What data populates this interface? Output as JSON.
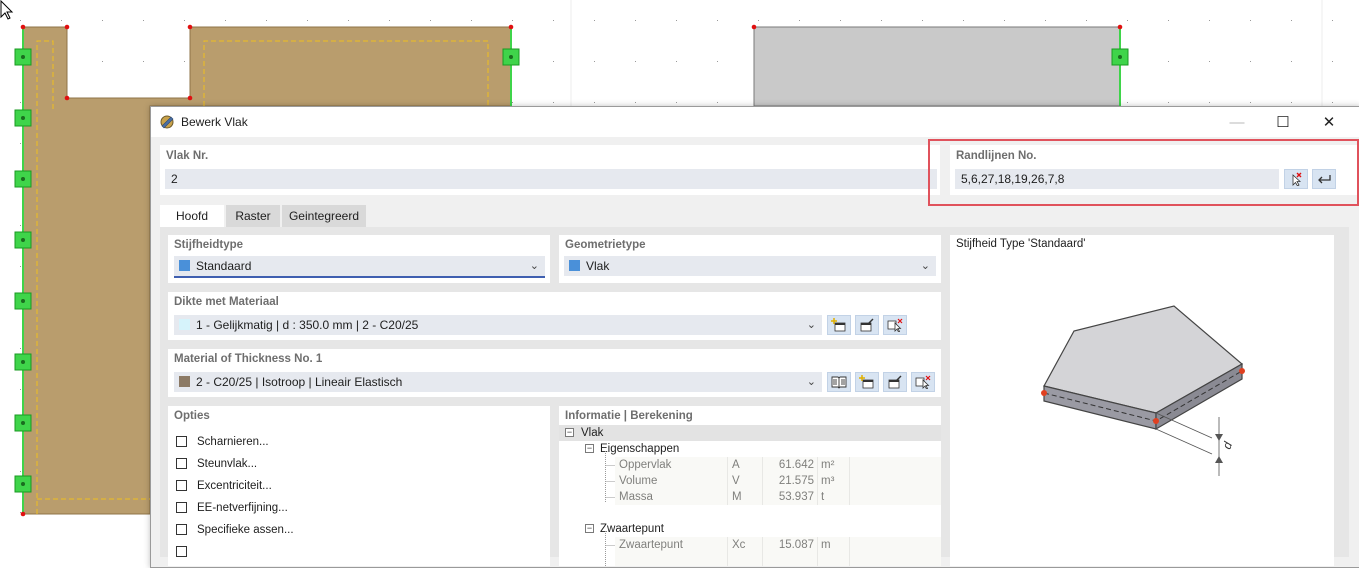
{
  "dialog": {
    "title": "Bewerk Vlak",
    "controls": {
      "minimize": "—",
      "maximize": "☐",
      "close": "✕"
    }
  },
  "surface_no": {
    "label": "Vlak Nr.",
    "value": "2"
  },
  "boundary_lines": {
    "label": "Randlijnen No.",
    "value": "5,6,27,18,19,26,7,8"
  },
  "tabs": [
    {
      "label": "Hoofd",
      "active": true
    },
    {
      "label": "Raster",
      "active": false
    },
    {
      "label": "Geintegreerd",
      "active": false
    }
  ],
  "stiffness_type": {
    "label": "Stijfheidtype",
    "value": "Standaard",
    "color": "#4a90d9"
  },
  "geometry_type": {
    "label": "Geometrietype",
    "value": "Vlak",
    "color": "#4a90d9"
  },
  "thickness": {
    "label": "Dikte met Materiaal",
    "value": "1 - Gelijkmatig | d : 350.0 mm | 2 - C20/25",
    "color": "#d6f3fb"
  },
  "material": {
    "label": "Material of Thickness No. 1",
    "value": "2 - C20/25 | Isotroop | Lineair Elastisch",
    "color": "#8c7a65"
  },
  "options": {
    "label": "Opties",
    "items": [
      "Scharnieren...",
      "Steunvlak...",
      "Excentriciteit...",
      "EE-netverfijning...",
      "Specifieke assen..."
    ]
  },
  "info": {
    "label": "Informatie | Berekening",
    "root": "Vlak",
    "groups": [
      {
        "name": "Eigenschappen",
        "rows": [
          {
            "name": "Oppervlak",
            "symbol": "A",
            "value": "61.642",
            "unit": "m²"
          },
          {
            "name": "Volume",
            "symbol": "V",
            "value": "21.575",
            "unit": "m³"
          },
          {
            "name": "Massa",
            "symbol": "M",
            "value": "53.937",
            "unit": "t"
          }
        ]
      },
      {
        "name": "Zwaartepunt",
        "rows": [
          {
            "name": "Zwaartepunt",
            "symbol": "Xc",
            "value": "15.087",
            "unit": "m"
          }
        ]
      }
    ]
  },
  "preview": {
    "label": "Stijfheid Type 'Standaard'",
    "dim_label": "d"
  },
  "colors": {
    "surface_fill": "#b99d6d",
    "surface_gray": "#c9c9c9",
    "node_red": "#e01010",
    "support_green": "#3fd44a",
    "highlight": "#e0525c",
    "accent_blue": "#3f5fb0"
  }
}
